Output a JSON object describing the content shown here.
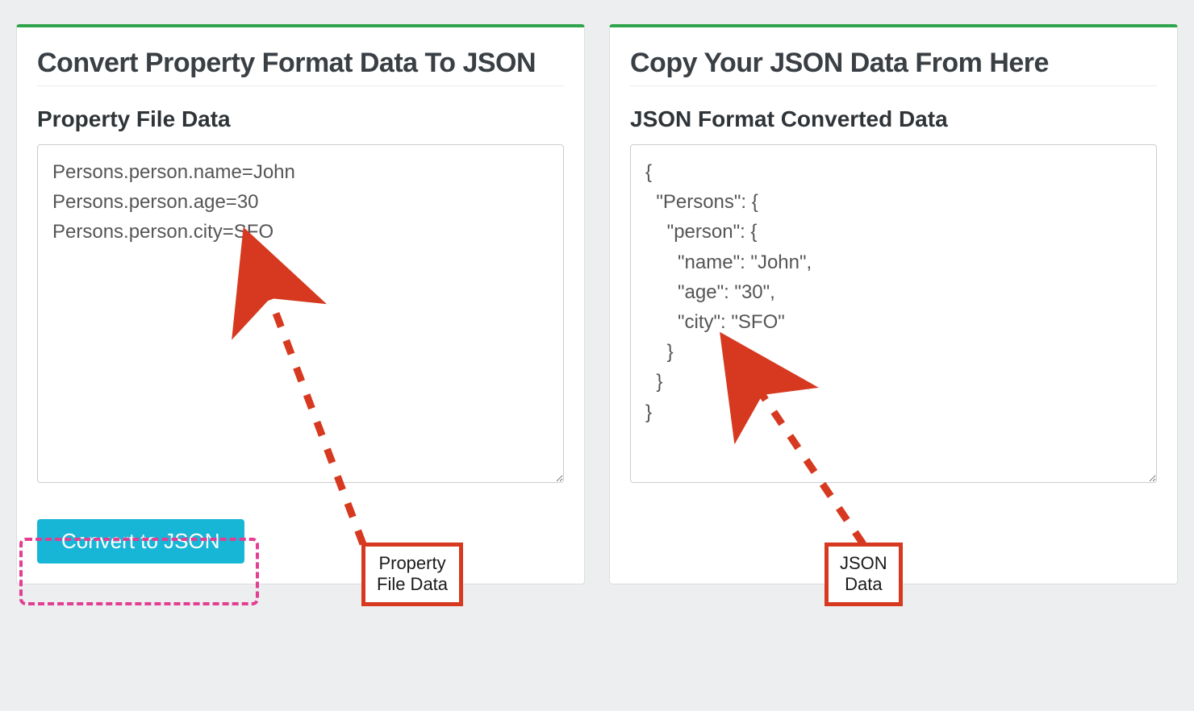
{
  "left": {
    "title": "Convert Property Format Data To JSON",
    "section_title": "Property File Data",
    "textarea_value": "Persons.person.name=John\nPersons.person.age=30\nPersons.person.city=SFO",
    "button_label": "Convert to JSON"
  },
  "right": {
    "title": "Copy Your JSON Data From Here",
    "section_title": "JSON Format Converted Data",
    "textarea_value": "{\n  \"Persons\": {\n    \"person\": {\n      \"name\": \"John\",\n      \"age\": \"30\",\n      \"city\": \"SFO\"\n    }\n  }\n}"
  },
  "annotations": {
    "left_label_line1": "Property",
    "left_label_line2": "File Data",
    "right_label_line1": "JSON",
    "right_label_line2": "Data"
  }
}
